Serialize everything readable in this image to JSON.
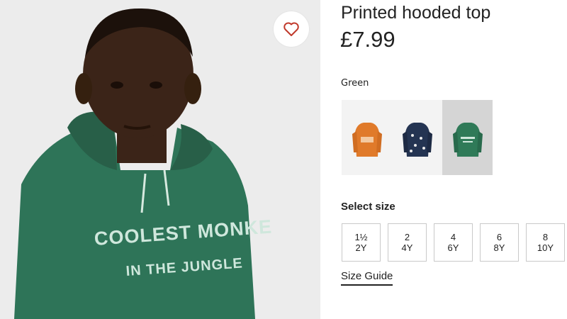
{
  "product": {
    "title": "Printed hooded top",
    "price": "£7.99",
    "favourite_icon": "heart-outline-icon",
    "image": {
      "print_line_1": "COOLEST MONKE",
      "print_line_2": "IN THE JUNGLE"
    }
  },
  "colour": {
    "selected_label": "Green",
    "swatches": [
      {
        "name": "orange-hoodie",
        "color": "#e07a2a",
        "selected": false
      },
      {
        "name": "navy-print-hoodie",
        "color": "#243452",
        "selected": false
      },
      {
        "name": "green-hoodie",
        "color": "#2f7a58",
        "selected": true
      }
    ]
  },
  "size": {
    "label": "Select size",
    "options": [
      {
        "top": "1½",
        "bottom": "2Y"
      },
      {
        "top": "2",
        "bottom": "4Y"
      },
      {
        "top": "4",
        "bottom": "6Y"
      },
      {
        "top": "6",
        "bottom": "8Y"
      },
      {
        "top": "8",
        "bottom": "10Y"
      }
    ],
    "guide_label": "Size Guide"
  },
  "colors": {
    "hoodie_green": "#2e7458",
    "print_text": "#cfe7dc",
    "skin": "#3b2418",
    "background": "#ececec"
  }
}
